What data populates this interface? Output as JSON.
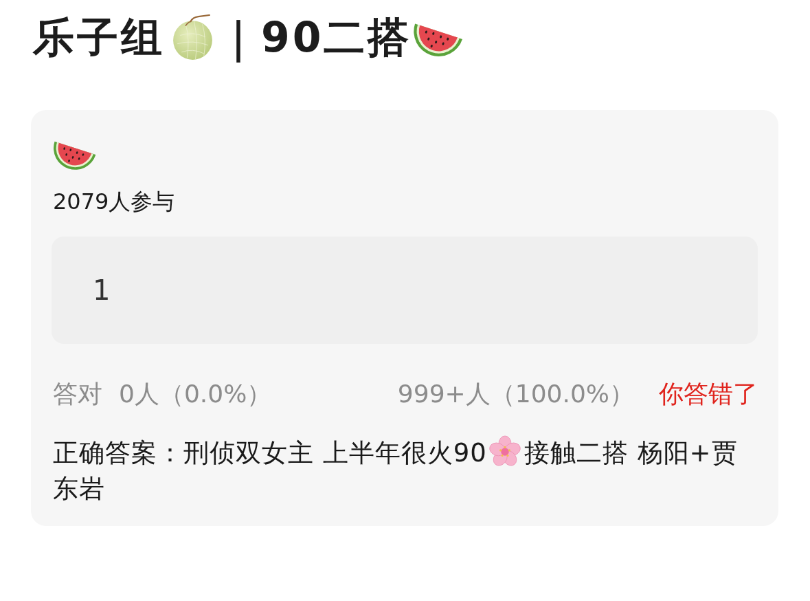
{
  "header": {
    "title_parts": [
      "乐子组",
      "｜90二搭"
    ]
  },
  "poll": {
    "participants": "2079人参与",
    "answer_box": {
      "value": "1"
    },
    "stats": {
      "correct_label": "答对",
      "correct_count": "0人（0.0%）",
      "answer_count": "999+人（100.0%）",
      "verdict": "你答错了",
      "correct": false
    },
    "correct_answer": {
      "parts": [
        "正确答案：刑侦双女主 上半年很火90",
        "接触二搭 杨阳+贾东岩"
      ]
    }
  }
}
